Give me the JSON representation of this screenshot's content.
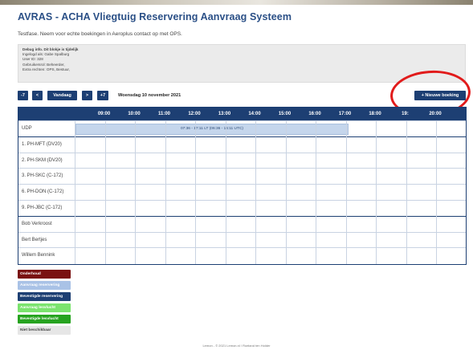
{
  "app": {
    "title": "AVRAS - ACHA Vliegtuig Reservering Aanvraag Systeem",
    "subtitle": "Testfase. Neem voor echte boekingen in Aeroplus contact op met OPS."
  },
  "debug": {
    "heading": "Debug info. Dit blokje is tijdelijk",
    "lines": [
      "Ingelogd als: Gabe Spalburg",
      "User ID: 328",
      "Gebruikersrol: Beheerder,",
      "Extra rechten: OPS, Bestuur,"
    ]
  },
  "nav": {
    "prev7": "-7",
    "prev": "<",
    "today": "Vandaag",
    "next": ">",
    "next7": "+7",
    "date": "Woensdag 10 november 2021"
  },
  "new_booking": "+ Nieuwe boeking",
  "schedule": {
    "hours": [
      "09:00",
      "10:00",
      "11:00",
      "12:00",
      "13:00",
      "14:00",
      "15:00",
      "16:00",
      "17:00",
      "18:00",
      "19:",
      "20:00"
    ],
    "rows": [
      {
        "label": "UDP"
      },
      {
        "label": "1. PH-MFT (DV20)"
      },
      {
        "label": "2. PH-SKM (DV20)"
      },
      {
        "label": "3. PH-SKC (C-172)"
      },
      {
        "label": "6. PH-DON (C-172)"
      },
      {
        "label": "9. PH-JBC (C-172)"
      },
      {
        "label": "Bob Verkroost"
      },
      {
        "label": "Bert Bertjes"
      },
      {
        "label": "Willem Bennink"
      }
    ],
    "booking": {
      "text": "07:36 - 17:11 LT (06:36 - 16:11 UTC)",
      "color": "#c5d6ec"
    }
  },
  "legend": [
    {
      "label": "Onderhoud",
      "color": "#7a1111",
      "text_color": "#ffffff"
    },
    {
      "label": "Aanvraag reservering",
      "color": "#a9c2e6",
      "text_color": "#ffffff"
    },
    {
      "label": "Bevestigde reservering",
      "color": "#1d3f73",
      "text_color": "#ffffff"
    },
    {
      "label": "Aanvraag lesvlucht",
      "color": "#7be36e",
      "text_color": "#ffffff"
    },
    {
      "label": "Bevestigde lesvlucht",
      "color": "#26a31f",
      "text_color": "#ffffff"
    },
    {
      "label": "Niet beschikbaar",
      "color": "#e6e6e6",
      "text_color": "#444444"
    }
  ],
  "footer": "Lemon - © 2021 Lemon.nl / Roeland ten Holder"
}
